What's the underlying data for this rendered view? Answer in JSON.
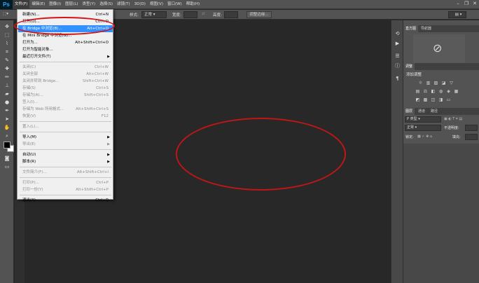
{
  "app": {
    "logo": "Ps"
  },
  "menubar": {
    "items": [
      "文件(F)",
      "编辑(E)",
      "图像(I)",
      "图层(L)",
      "类型(Y)",
      "选择(S)",
      "滤镜(T)",
      "3D(D)",
      "视图(V)",
      "窗口(W)",
      "帮助(H)"
    ]
  },
  "options_bar": {
    "style_label": "样式:",
    "style_value": "正常",
    "width_label": "宽度:",
    "height_label": "高度:",
    "refine_button": "调整边缘..."
  },
  "file_menu": {
    "items": [
      {
        "label": "新建(N)...",
        "shortcut": "Ctrl+N",
        "disabled": false
      },
      {
        "label": "打开(O)...",
        "shortcut": "Ctrl+O",
        "disabled": false
      },
      {
        "label": "在 Bridge 中浏览(B)...",
        "shortcut": "Alt+Ctrl+O",
        "disabled": false,
        "highlighted": true
      },
      {
        "label": "在 Mini Bridge 中浏览(G)...",
        "shortcut": "",
        "disabled": false
      },
      {
        "label": "打开为...",
        "shortcut": "Alt+Shift+Ctrl+O",
        "disabled": false
      },
      {
        "label": "打开为智能对象...",
        "shortcut": "",
        "disabled": false
      },
      {
        "label": "最近打开文件(T)",
        "shortcut": "",
        "disabled": false,
        "submenu": true
      },
      {
        "separator": true
      },
      {
        "label": "关闭(C)",
        "shortcut": "Ctrl+W",
        "disabled": true
      },
      {
        "label": "关闭全部",
        "shortcut": "Alt+Ctrl+W",
        "disabled": true
      },
      {
        "label": "关闭并转到 Bridge...",
        "shortcut": "Shift+Ctrl+W",
        "disabled": true
      },
      {
        "label": "存储(S)",
        "shortcut": "Ctrl+S",
        "disabled": true
      },
      {
        "label": "存储为(A)...",
        "shortcut": "Shift+Ctrl+S",
        "disabled": true
      },
      {
        "label": "签入(I)...",
        "shortcut": "",
        "disabled": true
      },
      {
        "label": "存储为 Web 所用格式...",
        "shortcut": "Alt+Shift+Ctrl+S",
        "disabled": true
      },
      {
        "label": "恢复(V)",
        "shortcut": "F12",
        "disabled": true
      },
      {
        "separator": true
      },
      {
        "label": "置入(L)...",
        "shortcut": "",
        "disabled": true
      },
      {
        "separator": true
      },
      {
        "label": "导入(M)",
        "shortcut": "",
        "disabled": false,
        "submenu": true
      },
      {
        "label": "导出(E)",
        "shortcut": "",
        "disabled": true,
        "submenu": true
      },
      {
        "separator": true
      },
      {
        "label": "自动(U)",
        "shortcut": "",
        "disabled": false,
        "submenu": true
      },
      {
        "label": "脚本(R)",
        "shortcut": "",
        "disabled": false,
        "submenu": true
      },
      {
        "separator": true
      },
      {
        "label": "文件简介(F)...",
        "shortcut": "Alt+Shift+Ctrl+I",
        "disabled": true
      },
      {
        "separator": true
      },
      {
        "label": "打印(P)...",
        "shortcut": "Ctrl+P",
        "disabled": true
      },
      {
        "label": "打印一份(Y)",
        "shortcut": "Alt+Shift+Ctrl+P",
        "disabled": true
      },
      {
        "separator": true
      },
      {
        "label": "退出(X)",
        "shortcut": "Ctrl+Q",
        "disabled": false
      }
    ]
  },
  "panels": {
    "histogram_tab": "直方图",
    "navigator_tab": "导航器",
    "adjustments_tab": "调整",
    "adjustments_title": "添加调整",
    "layers_tab": "图层",
    "channels_tab": "通道",
    "paths_tab": "路径",
    "kind_label": "P 类型",
    "blend_mode": "正常",
    "opacity_label": "不透明度:",
    "lock_label": "锁定:",
    "fill_label": "填充:"
  },
  "colors": {
    "accent_highlight": "#3390ff",
    "annotation_red": "#d21414",
    "workspace_bg": "#282828",
    "panel_bg": "#535353"
  }
}
